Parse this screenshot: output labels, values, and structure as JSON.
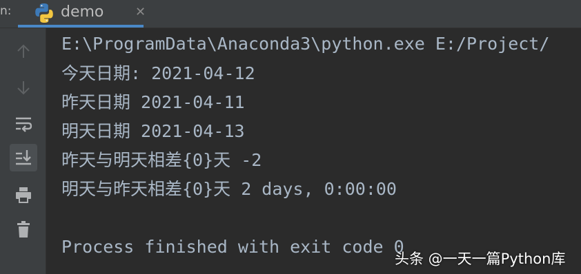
{
  "run_panel": {
    "label": "n:",
    "tab": {
      "title": "demo",
      "icon": "python-icon",
      "close_icon": "close-icon"
    }
  },
  "toolbar": {
    "items": [
      {
        "name": "up-arrow-icon"
      },
      {
        "name": "down-arrow-icon"
      },
      {
        "name": "soft-wrap-icon"
      },
      {
        "name": "scroll-to-end-icon",
        "active": true
      },
      {
        "name": "print-icon"
      },
      {
        "name": "trash-icon"
      }
    ]
  },
  "console": {
    "lines": [
      "E:\\ProgramData\\Anaconda3\\python.exe E:/Project/",
      "今天日期: 2021-04-12",
      "昨天日期 2021-04-11",
      "明天日期 2021-04-13",
      "昨天与明天相差{0}天 -2",
      "明天与昨天相差{0}天 2 days, 0:00:00",
      "",
      "Process finished with exit code 0"
    ]
  },
  "watermark": "头条 @一天一篇Python库",
  "colors": {
    "background": "#2b2b2b",
    "panel": "#3c3f41",
    "text": "#a9b7c6",
    "accent": "#4a88c7"
  }
}
